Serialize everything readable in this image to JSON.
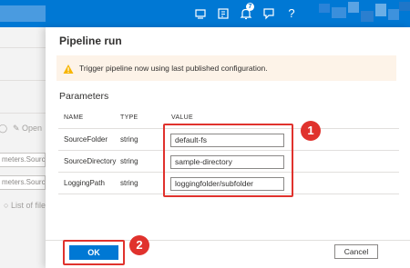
{
  "left_pane": {
    "open_label": "Open",
    "field1": "meters.SourceF",
    "field2": "meters.SourceD",
    "list_label": "List of file"
  },
  "panel": {
    "title": "Pipeline run",
    "warning": "Trigger pipeline now using last published configuration.",
    "section_title": "Parameters",
    "columns": {
      "name": "NAME",
      "type": "TYPE",
      "value": "VALUE"
    },
    "rows": [
      {
        "name": "SourceFolder",
        "type": "string",
        "value": "default-fs"
      },
      {
        "name": "SourceDirectory",
        "type": "string",
        "value": "sample-directory"
      },
      {
        "name": "LoggingPath",
        "type": "string",
        "value": "loggingfolder/subfolder"
      }
    ],
    "ok_label": "OK",
    "cancel_label": "Cancel"
  },
  "callouts": {
    "one": "1",
    "two": "2"
  },
  "topbar": {
    "notification_count": "7"
  },
  "colors": {
    "accent": "#0078d4",
    "callout": "#e0322d",
    "warning_bg": "#fdf3e8"
  }
}
